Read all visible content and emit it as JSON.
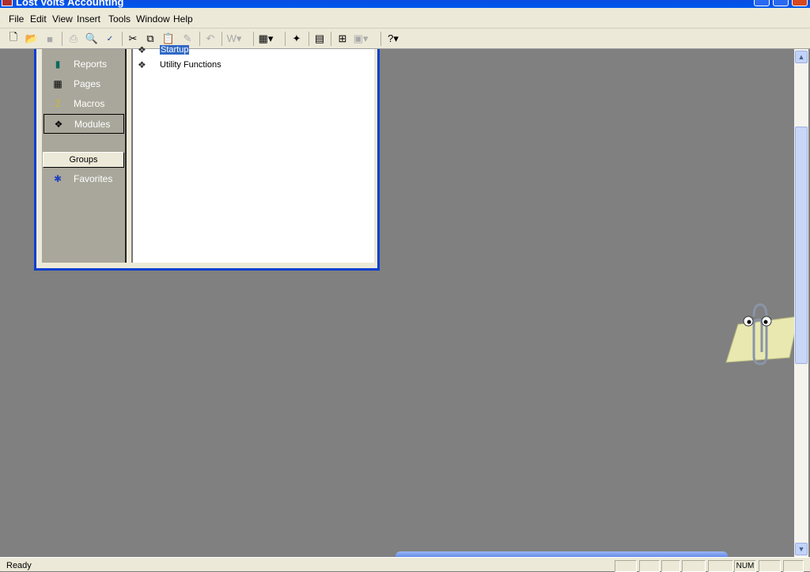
{
  "window": {
    "title": "Lost Volts Accounting"
  },
  "menu": [
    "File",
    "Edit",
    "View",
    "Insert",
    "Tools",
    "Window",
    "Help"
  ],
  "toolbar": {
    "icons": [
      "new-icon",
      "open-icon",
      "save-icon",
      "print-icon",
      "print-preview-icon",
      "spelling-icon",
      "cut-icon",
      "copy-icon",
      "paste-icon",
      "format-painter-icon",
      "undo-icon",
      "office-links-icon",
      "analyze-icon",
      "code-icon",
      "properties-icon",
      "relationships-icon",
      "new-object-icon",
      "help-icon"
    ]
  },
  "database_window": {
    "objects": [
      {
        "label": "Reports",
        "icon": "report-icon"
      },
      {
        "label": "Pages",
        "icon": "page-icon"
      },
      {
        "label": "Macros",
        "icon": "macro-icon"
      },
      {
        "label": "Modules",
        "icon": "module-icon",
        "selected": true
      }
    ],
    "groups_label": "Groups",
    "groups": [
      {
        "label": "Favorites",
        "icon": "favorites-folder-icon"
      }
    ],
    "items": [
      {
        "label": "Startup",
        "selected": true
      },
      {
        "label": "Utility Functions"
      }
    ]
  },
  "status": {
    "text": "Ready",
    "num": "NUM"
  },
  "colors": {
    "workspace": "#808080",
    "selection": "#316ac5",
    "titlebar": "#0058ee"
  }
}
